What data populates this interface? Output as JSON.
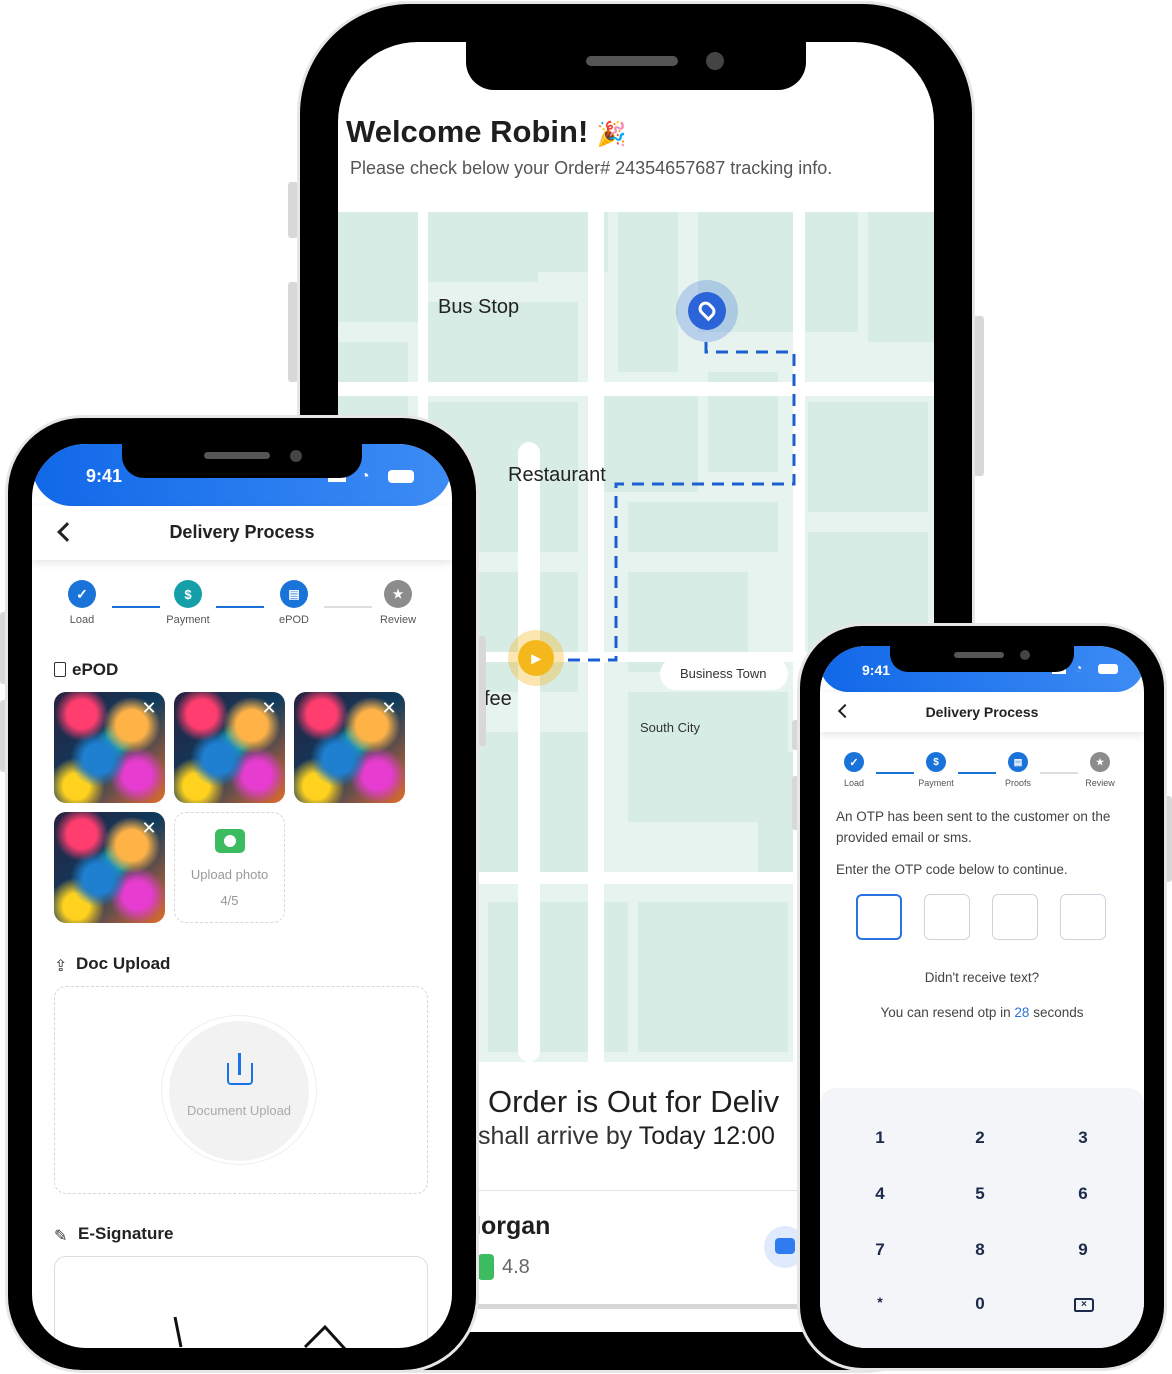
{
  "tracking_phone": {
    "welcome_title": "Welcome Robin!",
    "welcome_emoji": "🎉",
    "subtitle": "Please check below your Order# 24354657687 tracking info.",
    "map_labels": {
      "bus_stop": "Bus Stop",
      "restaurant": "Restaurant",
      "coffee": "fee",
      "business_town": "Business Town",
      "south_city": "South City"
    },
    "order_status": "Order is Out for Deliv",
    "arrival_text": "shall arrive by",
    "arrival_time": "Today 12:00",
    "driver_name": "lorgan",
    "driver_rating": "4.8"
  },
  "left_phone": {
    "status_time": "9:41",
    "nav_title": "Delivery Process",
    "steps": [
      {
        "label": "Load",
        "color": "#1a73d9",
        "icon": "check-icon"
      },
      {
        "label": "Payment",
        "color": "#159fa8",
        "icon": "dollar-icon"
      },
      {
        "label": "ePOD",
        "color": "#1a73d9",
        "icon": "document-icon"
      },
      {
        "label": "Review",
        "color": "#8c8c8c",
        "icon": "star-icon"
      }
    ],
    "epod_title": "ePOD",
    "upload_photo_label": "Upload photo",
    "upload_photo_count": "4/5",
    "doc_upload_title": "Doc Upload",
    "doc_upload_label": "Document Upload",
    "esignature_title": "E-Signature"
  },
  "right_phone": {
    "status_time": "9:41",
    "nav_title": "Delivery Process",
    "steps": [
      {
        "label": "Load",
        "color": "#1a73d9"
      },
      {
        "label": "Payment",
        "color": "#1a73d9"
      },
      {
        "label": "Proofs",
        "color": "#1a73d9"
      },
      {
        "label": "Review",
        "color": "#8c8c8c"
      }
    ],
    "otp_message": "An OTP has been sent to the customer on the provided email or sms.",
    "otp_instruction": "Enter the OTP code below to continue.",
    "not_received": "Didn't receive text?",
    "resend_prefix": "You can resend otp in",
    "resend_seconds": "28",
    "resend_suffix": "seconds",
    "keypad": [
      "1",
      "2",
      "3",
      "4",
      "5",
      "6",
      "7",
      "8",
      "9",
      "*",
      "0"
    ]
  },
  "colors": {
    "brand_blue": "#1a73e8",
    "map_bg": "#e7f3ef",
    "route": "#1c5fd1",
    "pin_yellow": "#f5b81c",
    "chat_blue": "#2f7bf0",
    "camera_green": "#3dbb61"
  }
}
